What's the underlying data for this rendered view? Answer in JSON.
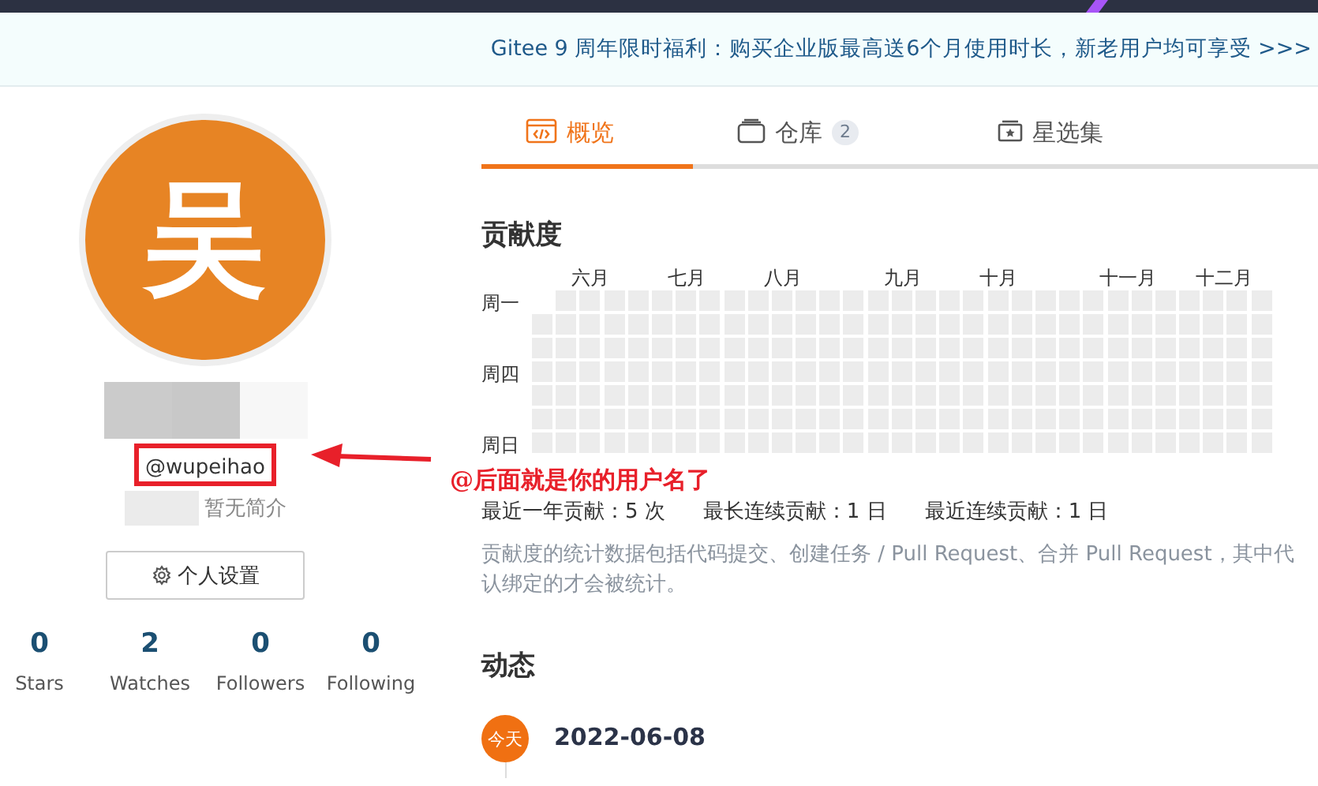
{
  "banner": {
    "text": "Gitee 9 周年限时福利：购买企业版最高送6个月使用时长，新老用户均可享受 >>>"
  },
  "profile": {
    "avatar_letter": "吴",
    "username": "@wupeihao",
    "bio": "暂无简介",
    "settings_button": "个人设置",
    "stats": [
      {
        "value": "0",
        "label": "Stars"
      },
      {
        "value": "2",
        "label": "Watches"
      },
      {
        "value": "0",
        "label": "Followers"
      },
      {
        "value": "0",
        "label": "Following"
      }
    ]
  },
  "tabs": [
    {
      "label": "概览",
      "kind": "overview",
      "selected": true
    },
    {
      "label": "仓库",
      "kind": "repos",
      "count": "2",
      "selected": false
    },
    {
      "label": "星选集",
      "kind": "stars",
      "selected": false
    }
  ],
  "contribution": {
    "title": "贡献度",
    "months": [
      "六月",
      "七月",
      "八月",
      "九月",
      "十月",
      "十一月",
      "十二月"
    ],
    "weekdays": [
      "周一",
      "周四",
      "周日"
    ],
    "summary": [
      "最近一年贡献：5 次",
      "最长连续贡献：1 日",
      "最近连续贡献：1 日"
    ],
    "note_lines": [
      "贡献度的统计数据包括代码提交、创建任务 / Pull Request、合并 Pull Request，其中代",
      "认绑定的才会被统计。"
    ]
  },
  "activity": {
    "title": "动态",
    "items": [
      {
        "badge": "今天",
        "date": "2022-06-08"
      }
    ]
  },
  "annotation": {
    "text": "@后面就是你的用户名了"
  }
}
